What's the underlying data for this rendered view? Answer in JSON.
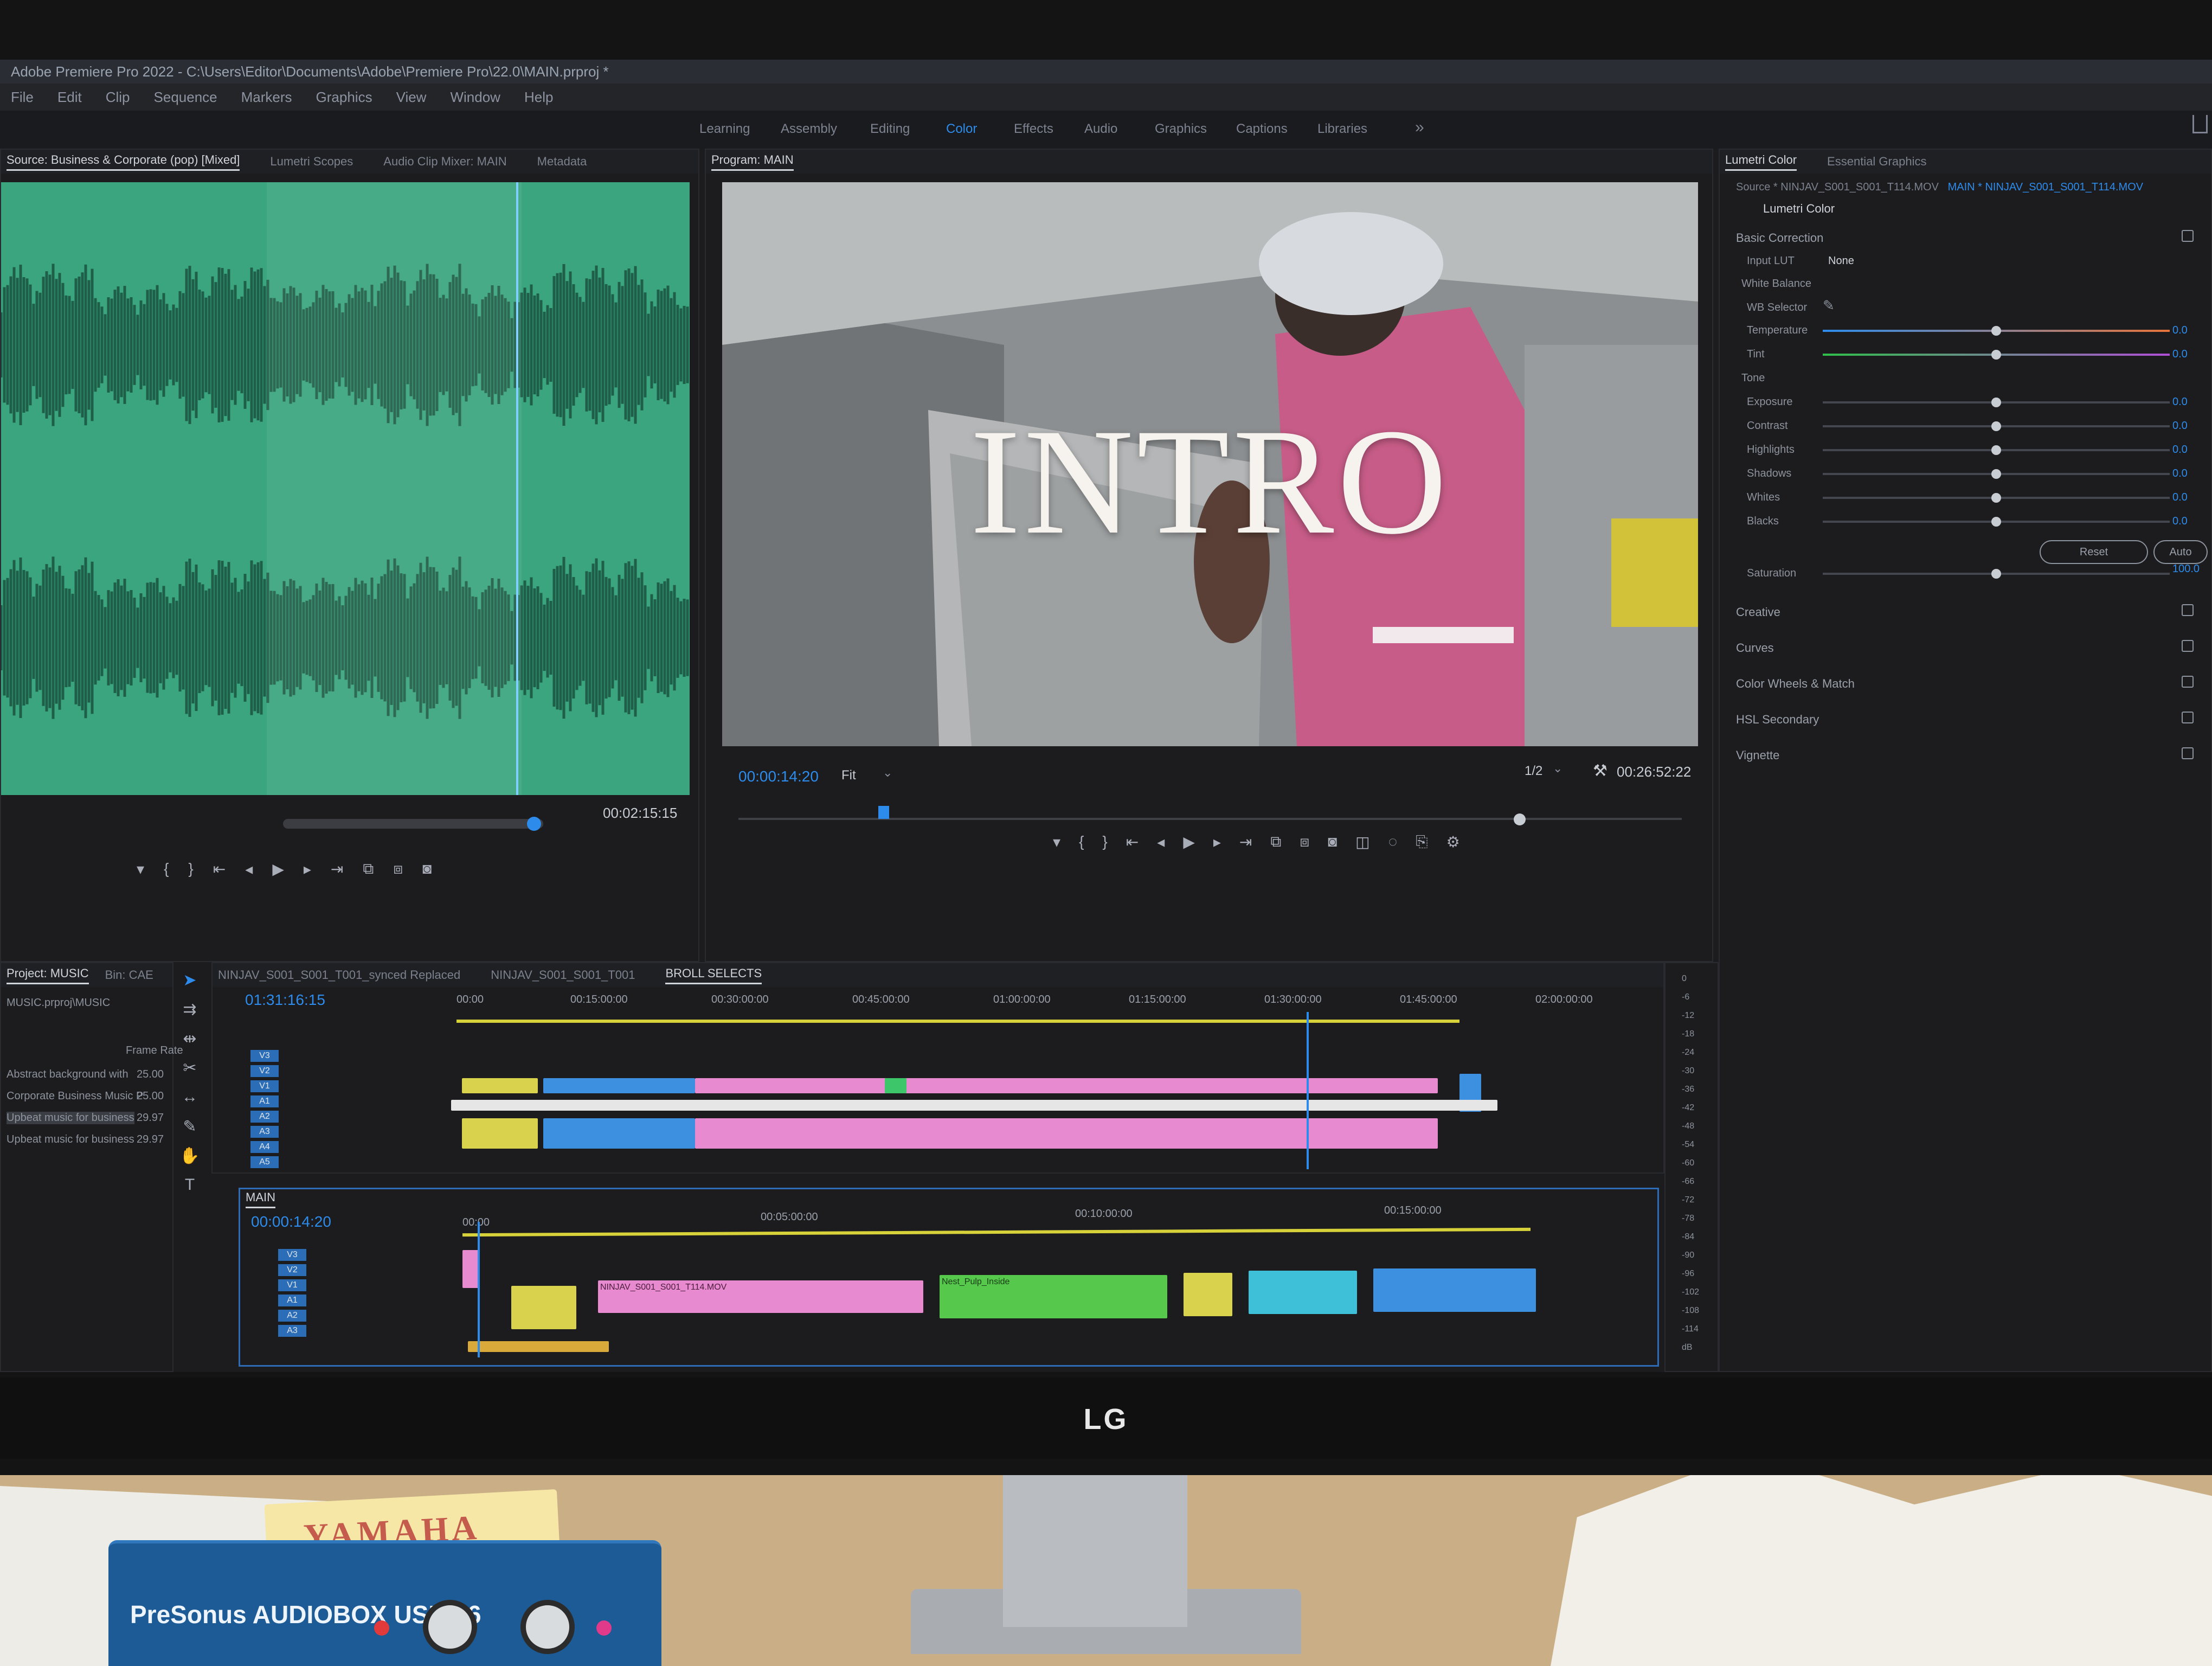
{
  "window": {
    "title": "Adobe Premiere Pro 2022 - C:\\Users\\Editor\\Documents\\Adobe\\Premiere Pro\\22.0\\MAIN.prproj *"
  },
  "menu": [
    "File",
    "Edit",
    "Clip",
    "Sequence",
    "Markers",
    "Graphics",
    "View",
    "Window",
    "Help"
  ],
  "workspaces": {
    "tabs": [
      "Learning",
      "Assembly",
      "Editing",
      "Color",
      "Effects",
      "Audio",
      "Graphics",
      "Captions",
      "Libraries"
    ],
    "active": "Color",
    "more": "»"
  },
  "source_panel": {
    "tabs": [
      "Source: Business & Corporate (pop) [Mixed]",
      "Lumetri Scopes",
      "Audio Clip Mixer: MAIN",
      "Metadata"
    ],
    "active_tab": "Source: Business & Corporate (pop) [Mixed]",
    "duration": "00:02:15:15",
    "wave_color": "#3aa57e"
  },
  "program_panel": {
    "tab": "Program: MAIN",
    "overlay_title": "INTRO",
    "timecode": "00:00:14:20",
    "fit": "Fit",
    "resolution": "1/2",
    "duration": "00:26:52:22"
  },
  "lumetri": {
    "tabs": [
      "Lumetri Color",
      "Essential Graphics"
    ],
    "active_tab": "Lumetri Color",
    "source": "Source * NINJAV_S001_S001_T114.MOV",
    "sequence": "MAIN * NINJAV_S001_S001_T114.MOV",
    "effect": "Lumetri Color",
    "basic": "Basic Correction",
    "input_lut_label": "Input LUT",
    "input_lut_value": "None",
    "white_balance": "White Balance",
    "wb_selector": "WB Selector",
    "tone": "Tone",
    "sliders": [
      {
        "label": "Temperature",
        "value": "0.0"
      },
      {
        "label": "Tint",
        "value": "0.0"
      },
      {
        "label": "Exposure",
        "value": "0.0"
      },
      {
        "label": "Contrast",
        "value": "0.0"
      },
      {
        "label": "Highlights",
        "value": "0.0"
      },
      {
        "label": "Shadows",
        "value": "0.0"
      },
      {
        "label": "Whites",
        "value": "0.0"
      },
      {
        "label": "Blacks",
        "value": "0.0"
      }
    ],
    "reset": "Reset",
    "auto": "Auto",
    "saturation": {
      "label": "Saturation",
      "value": "100.0"
    },
    "sections": [
      "Creative",
      "Curves",
      "Color Wheels & Match",
      "HSL Secondary",
      "Vignette"
    ]
  },
  "project_panel": {
    "tabs": [
      "Project: MUSIC",
      "Bin: CAE"
    ],
    "path": "MUSIC.prproj\\MUSIC",
    "column": "Frame Rate",
    "items": [
      {
        "name": "Abstract background with",
        "rate": "25.00"
      },
      {
        "name": "Corporate Business Music P",
        "rate": "25.00"
      },
      {
        "name": "Upbeat music for business",
        "rate": "29.97"
      },
      {
        "name": "Upbeat music for business",
        "rate": "29.97"
      }
    ]
  },
  "timeline_top": {
    "tabs": [
      "NINJAV_S001_S001_T001_synced Replaced",
      "NINJAV_S001_S001_T001",
      "BROLL SELECTS"
    ],
    "active_tab": "BROLL SELECTS",
    "timecode": "01:31:16:15",
    "ruler": [
      "00:00",
      "00:15:00:00",
      "00:30:00:00",
      "00:45:00:00",
      "01:00:00:00",
      "01:15:00:00",
      "01:30:00:00",
      "01:45:00:00",
      "02:00:00:00"
    ],
    "tracks": [
      "V3",
      "V2",
      "V1",
      "A1",
      "A2",
      "A3",
      "A4",
      "A5"
    ]
  },
  "timeline_main": {
    "tab": "MAIN",
    "timecode": "00:00:14:20",
    "ruler": [
      "00:00",
      "00:05:00:00",
      "00:10:00:00",
      "00:15:00:00"
    ],
    "tracks": [
      "V3",
      "V2",
      "V1",
      "A1",
      "A2",
      "A3"
    ],
    "clip_labels": [
      "NINJAV_S001_S001_T114.MOV",
      "Nest_Pulp_Inside"
    ]
  },
  "meter_ticks": [
    "0",
    "-6",
    "-12",
    "-18",
    "-24",
    "-30",
    "-36",
    "-42",
    "-48",
    "-54",
    "-60",
    "-66",
    "-72",
    "-78",
    "-84",
    "-90",
    "-96",
    "-102",
    "-108",
    "-114",
    "dB"
  ],
  "desk": {
    "monitor_brand": "LG",
    "interface_brand": "PreSonus AUDIOBOX USB 96",
    "sticker": "YAMAHA"
  }
}
